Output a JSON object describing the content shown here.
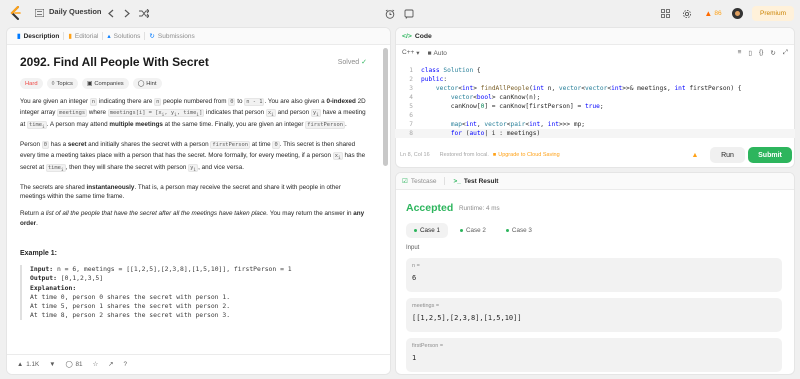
{
  "topbar": {
    "title": "Daily Question",
    "streak": "86",
    "premium": "Premium"
  },
  "left": {
    "tabs": [
      "Description",
      "Editorial",
      "Solutions",
      "Submissions"
    ],
    "title": "2092. Find All People With Secret",
    "solved": "Solved",
    "badges": [
      "Hard",
      "Topics",
      "Companies",
      "Hint"
    ],
    "example_title": "Example 1:",
    "example": {
      "input_label": "Input:",
      "input": " n = 6, meetings = [[1,2,5],[2,3,8],[1,5,10]], firstPerson = 1",
      "output_label": "Output:",
      "output": " [0,1,2,3,5]",
      "explanation_label": "Explanation:",
      "lines": [
        "At time 0, person 0 shares the secret with person 1.",
        "At time 5, person 1 shares the secret with person 2.",
        "At time 8, person 2 shares the secret with person 3."
      ]
    },
    "footer": {
      "likes": "1.1K",
      "comments": "81"
    }
  },
  "code": {
    "header": "Code",
    "language": "C++",
    "auto": "Auto",
    "status_pos": "Ln 8, Col 16",
    "status_restored": "Restored from local.",
    "status_upgrade": "Upgrade to Cloud Saving",
    "run": "Run",
    "submit": "Submit"
  },
  "result": {
    "tabs": [
      "Testcase",
      "Test Result"
    ],
    "status": "Accepted",
    "runtime": "Runtime: 4 ms",
    "cases": [
      "Case 1",
      "Case 2",
      "Case 3"
    ],
    "input_label": "Input",
    "fields": [
      {
        "name": "n =",
        "value": "6"
      },
      {
        "name": "meetings =",
        "value": "[[1,2,5],[2,3,8],[1,5,10]]"
      },
      {
        "name": "firstPerson =",
        "value": "1"
      }
    ]
  },
  "colors": {
    "accent_green": "#2db55d",
    "hard_red": "#ef4743",
    "premium_orange": "#ffa116"
  }
}
